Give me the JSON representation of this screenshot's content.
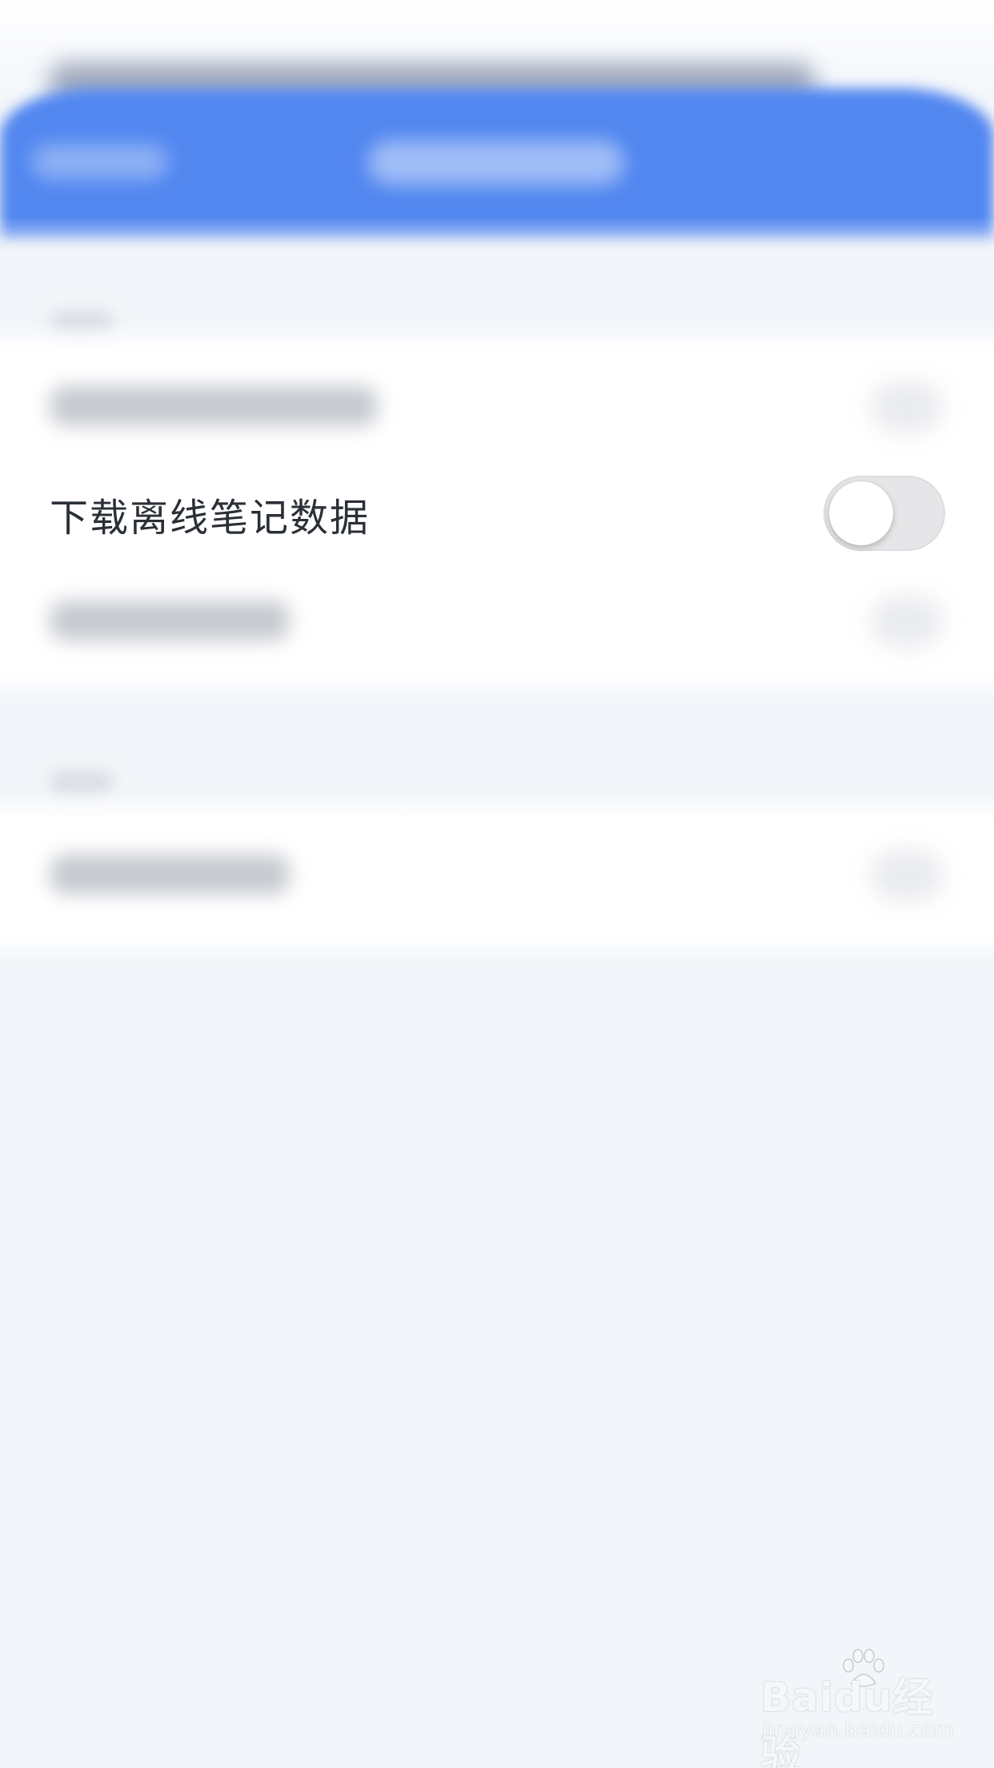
{
  "settings": {
    "offline_notes_row": {
      "label": "下载离线笔记数据",
      "toggle_state": "off"
    }
  },
  "watermark": {
    "logo_text": "Baidu经验",
    "url_text": "jingyan.baidu.com"
  },
  "colors": {
    "nav_bar": "#5287f0",
    "background": "#f2f5f9",
    "card": "#ffffff",
    "label_text": "#2b2f36",
    "toggle_off_track": "#e6e6e8"
  }
}
